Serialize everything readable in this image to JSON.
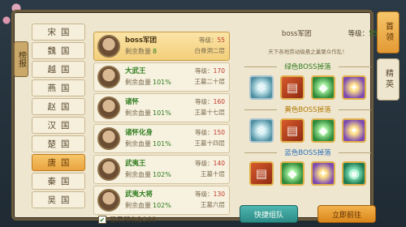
{
  "left_side_tab": "榜报",
  "kingdoms": [
    "宋国",
    "魏国",
    "越国",
    "燕国",
    "赵国",
    "汉国",
    "楚国",
    "唐国",
    "秦国",
    "吴国"
  ],
  "active_kingdom_index": 7,
  "boss_list": [
    {
      "name": "boss军团",
      "count_label": "剩余数量",
      "count": "8",
      "level_label": "等级：",
      "level": "55",
      "location": "白骨洞二层",
      "active": true
    },
    {
      "name": "大武王",
      "count_label": "剩余血量",
      "count": "101%",
      "level_label": "等级：",
      "level": "170",
      "location": "王墓二十层",
      "active": false
    },
    {
      "name": "诸怀",
      "count_label": "剩余血量",
      "count": "101%",
      "level_label": "等级：",
      "level": "160",
      "location": "王墓十七层",
      "active": false
    },
    {
      "name": "诸怀化身",
      "count_label": "剩余血量",
      "count": "101%",
      "level_label": "等级：",
      "level": "150",
      "location": "王墓十四层",
      "active": false
    },
    {
      "name": "武夷王",
      "count_label": "剩余血量",
      "count": "102%",
      "level_label": "等级：",
      "level": "140",
      "location": "王墓十层",
      "active": false
    },
    {
      "name": "武夷大将",
      "count_label": "剩余血量",
      "count": "102%",
      "level_label": "等级：",
      "level": "130",
      "location": "王墓六层",
      "active": false
    }
  ],
  "show_all_label": "显示所有BOSS",
  "show_all_checked": true,
  "detail": {
    "title": "boss军团",
    "level_label": "等级：",
    "level": "55",
    "subtitle": "天下各地劳动级悬之巢聚众作乱！",
    "drops": [
      {
        "title": "绿色BOSS掉落",
        "color": "green",
        "items": [
          "teal",
          "red",
          "green",
          "gold"
        ]
      },
      {
        "title": "黄色BOSS掉落",
        "color": "yellow",
        "items": [
          "teal",
          "red",
          "green",
          "gold"
        ]
      },
      {
        "title": "蓝色BOSS掉落",
        "color": "blue",
        "items": [
          "red",
          "green",
          "gold",
          "emerald"
        ]
      }
    ],
    "btn_team": "快捷组队",
    "btn_go": "立即前往"
  },
  "right_tabs": [
    {
      "label": "首领",
      "active": true
    },
    {
      "label": "精英",
      "active": false
    }
  ],
  "colors": {
    "accent": "#e9a43f",
    "frame": "#6b5a3c",
    "panel": "#efe6cf"
  }
}
